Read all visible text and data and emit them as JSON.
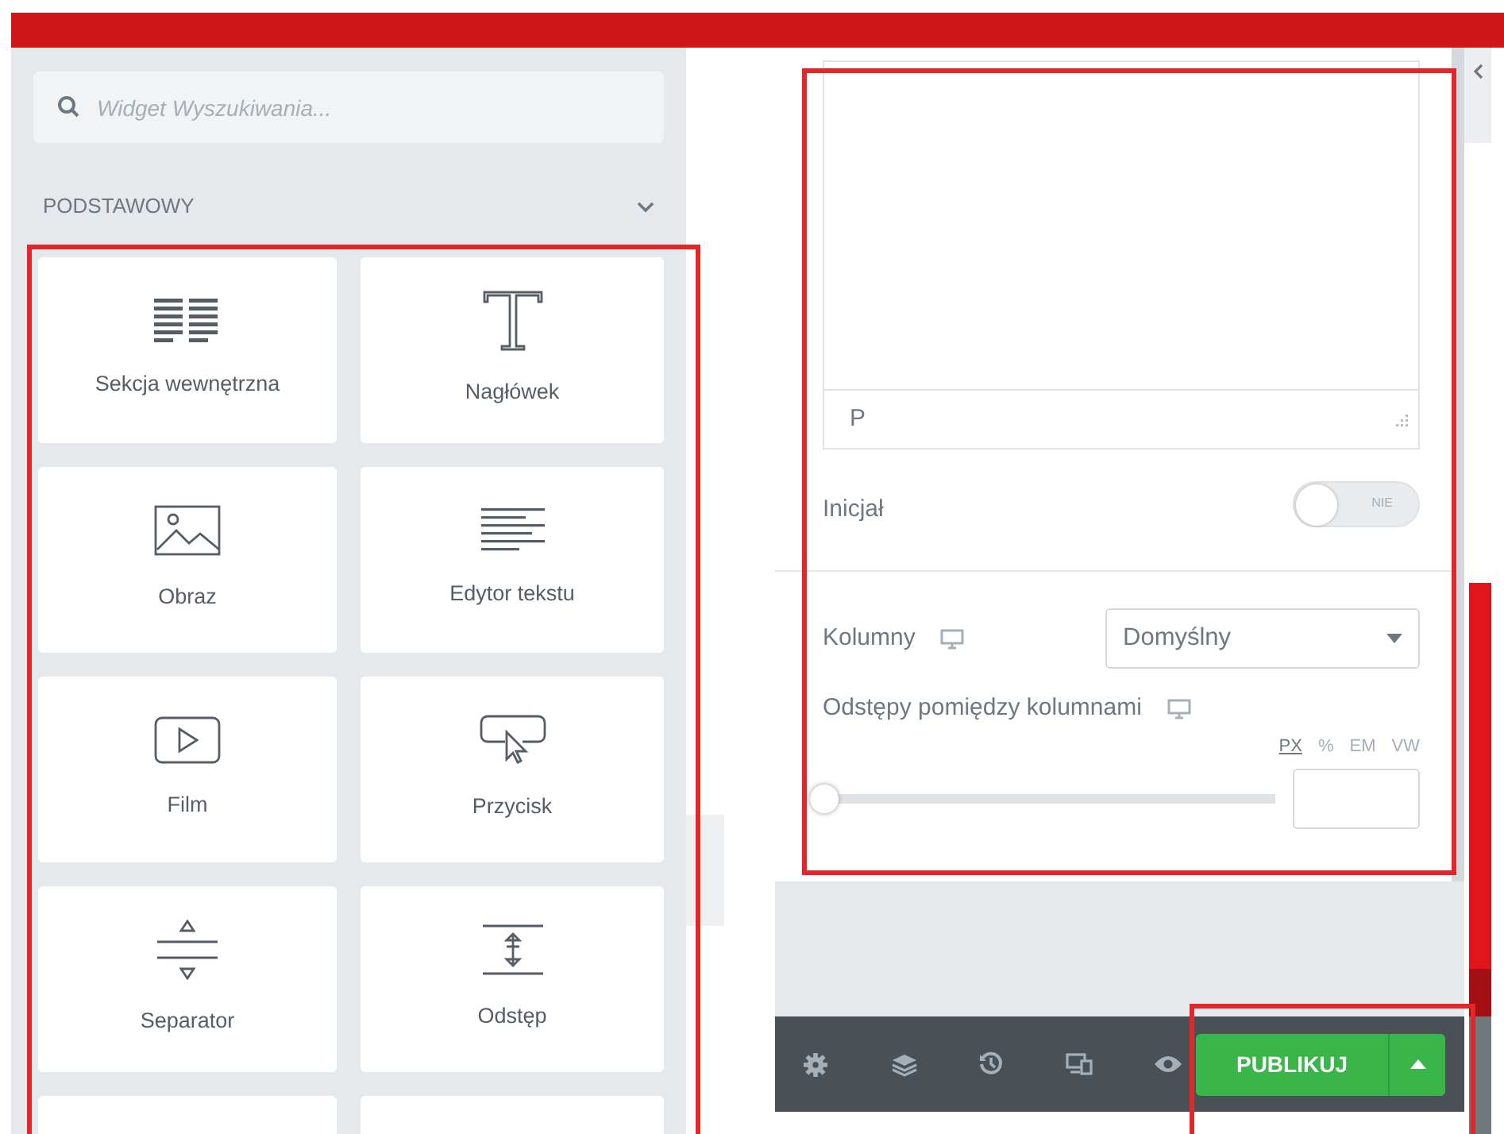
{
  "search": {
    "placeholder": "Widget Wyszukiwania..."
  },
  "category": {
    "title": "PODSTAWOWY",
    "expanded": true
  },
  "widgets": [
    {
      "label": "Sekcja wewnętrzna",
      "kind": "section"
    },
    {
      "label": "Nagłówek",
      "kind": "heading"
    },
    {
      "label": "Obraz",
      "kind": "image"
    },
    {
      "label": "Edytor tekstu",
      "kind": "text"
    },
    {
      "label": "Film",
      "kind": "video"
    },
    {
      "label": "Przycisk",
      "kind": "button"
    },
    {
      "label": "Separator",
      "kind": "divider"
    },
    {
      "label": "Odstęp",
      "kind": "spacer"
    },
    {
      "kind": "partial"
    },
    {
      "kind": "partial"
    }
  ],
  "editor": {
    "path": "P"
  },
  "drop_cap": {
    "label": "Inicjał",
    "on": false,
    "off_text": "NIE"
  },
  "columns": {
    "label": "Kolumny",
    "value": "Domyślny"
  },
  "gap": {
    "label": "Odstępy pomiędzy kolumnami",
    "units": [
      {
        "label": "PX",
        "selected": true
      },
      {
        "label": "%",
        "selected": false
      },
      {
        "label": "EM",
        "selected": false
      },
      {
        "label": "VW",
        "selected": false
      }
    ],
    "level": 0
  },
  "footer": {
    "publish": "PUBLIKUJ"
  }
}
